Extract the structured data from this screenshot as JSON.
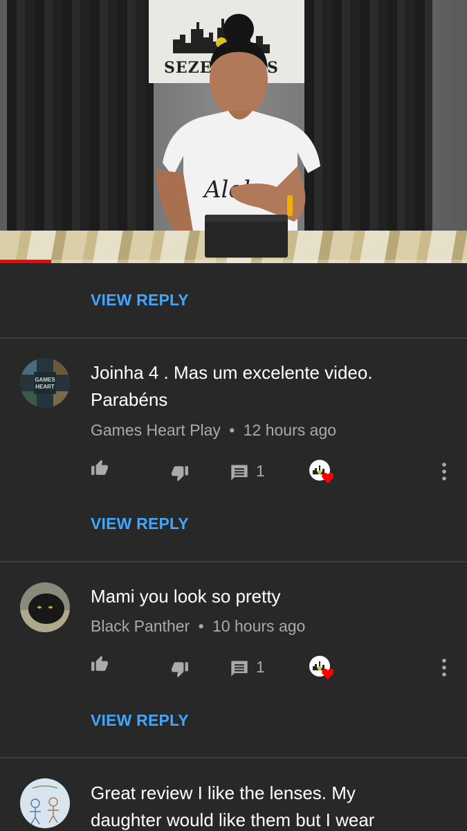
{
  "colors": {
    "background": "#282828",
    "link": "#3ea6ff",
    "secondary_text": "#aaaaaa",
    "progress": "#ff0000",
    "heart": "#ff0000"
  },
  "video": {
    "banner_text_left": "SEZEN",
    "banner_text_right": "S",
    "progress_fraction": 0.11
  },
  "top_reply": {
    "label": "VIEW REPLY"
  },
  "comments": [
    {
      "text_line1": "Joinha 4 . Mas um excelente video.",
      "text_line2": "Parabéns",
      "author": "Games Heart Play",
      "separator": "•",
      "time": "12 hours ago",
      "reply_count": "1",
      "view_reply": "VIEW REPLY",
      "avatar_text": "GAMES HEART",
      "icons": [
        "like-icon",
        "dislike-icon",
        "reply-icon",
        "creator-heart-icon",
        "more-options-icon"
      ]
    },
    {
      "text_line1": "Mami you look so pretty",
      "author": "Black Panther",
      "separator": "•",
      "time": "10 hours ago",
      "reply_count": "1",
      "view_reply": "VIEW REPLY",
      "icons": [
        "like-icon",
        "dislike-icon",
        "reply-icon",
        "creator-heart-icon",
        "more-options-icon"
      ]
    },
    {
      "text_line1": "Great review I like the lenses. My",
      "text_line2": "daughter would like them but I wear"
    }
  ]
}
